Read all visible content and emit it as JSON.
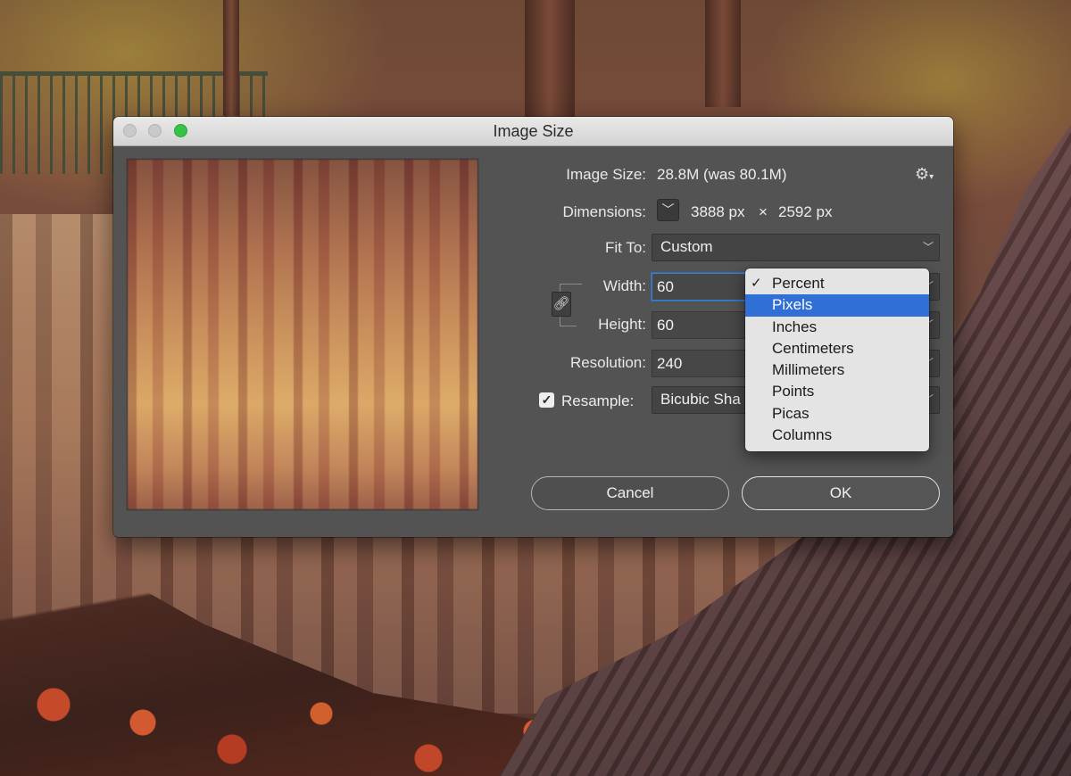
{
  "dialog": {
    "title": "Image Size",
    "image_size": {
      "label": "Image Size:",
      "value": "28.8M (was 80.1M)"
    },
    "dimensions": {
      "label": "Dimensions:",
      "width": "3888 px",
      "times": "×",
      "height": "2592 px"
    },
    "fit_to": {
      "label": "Fit To:",
      "value": "Custom"
    },
    "width": {
      "label": "Width:",
      "value": "60"
    },
    "height": {
      "label": "Height:",
      "value": "60"
    },
    "resolution": {
      "label": "Resolution:",
      "value": "240"
    },
    "resample": {
      "label": "Resample:",
      "value": "Bicubic Sha",
      "checked": true
    },
    "cancel_label": "Cancel",
    "ok_label": "OK",
    "icons": {
      "gear": "gear-icon",
      "chain": "chain-link-icon",
      "chevron": "chevron-down-icon",
      "check": "checkmark-icon"
    }
  },
  "unit_menu": {
    "selected": "Percent",
    "highlighted": "Pixels",
    "items": [
      "Percent",
      "Pixels",
      "Inches",
      "Centimeters",
      "Millimeters",
      "Points",
      "Picas",
      "Columns"
    ]
  },
  "colors": {
    "highlight": "#2f6fd6",
    "zoom_button": "#37c24a",
    "dialog_bg": "#535353"
  }
}
